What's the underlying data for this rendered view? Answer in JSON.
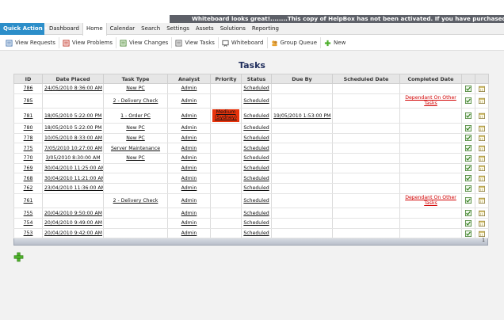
{
  "notice": "Whiteboard looks great!........This copy of HelpBox has not been activated. If you have purchased HelpBox, p",
  "menu": {
    "quick_action": "Quick Action ▾",
    "items": [
      "Dashboard",
      "Home",
      "Calendar",
      "Search",
      "Settings",
      "Assets",
      "Solutions",
      "Reporting"
    ]
  },
  "toolbar": {
    "buttons": [
      "View Requests",
      "View Problems",
      "View Changes",
      "View Tasks",
      "Whiteboard",
      "Group Queue",
      "New"
    ]
  },
  "page_title": "Tasks",
  "table": {
    "headers": [
      "ID",
      "Date Placed",
      "Task Type",
      "Analyst",
      "Priority",
      "Status",
      "Due By",
      "Scheduled Date",
      "Completed Date"
    ],
    "rows": [
      [
        "786",
        "24/05/2010 8:36:00 AM",
        "New PC",
        "Admin",
        "",
        "Scheduled",
        "",
        "",
        ""
      ],
      [
        "785",
        "",
        "2 - Delivery Check",
        "Admin",
        "",
        "Scheduled",
        "",
        "",
        "Dependant On Other Tasks"
      ],
      [
        "781",
        "18/05/2010 5:22:00 PM",
        "1 - Order PC",
        "Admin",
        "Medium (Sydney)",
        "Scheduled",
        "19/05/2010 1:53:00 PM",
        "",
        ""
      ],
      [
        "780",
        "18/05/2010 5:22:00 PM",
        "New PC",
        "Admin",
        "",
        "Scheduled",
        "",
        "",
        ""
      ],
      [
        "778",
        "10/05/2010 8:33:00 AM",
        "New PC",
        "Admin",
        "",
        "Scheduled",
        "",
        "",
        ""
      ],
      [
        "775",
        "7/05/2010 10:27:00 AM",
        "Server Maintenance",
        "Admin",
        "",
        "Scheduled",
        "",
        "",
        ""
      ],
      [
        "770",
        "3/05/2010 8:30:00 AM",
        "New PC",
        "Admin",
        "",
        "Scheduled",
        "",
        "",
        ""
      ],
      [
        "769",
        "30/04/2010 11:25:00 AM",
        "",
        "Admin",
        "",
        "Scheduled",
        "",
        "",
        ""
      ],
      [
        "768",
        "30/04/2010 11:21:00 AM",
        "",
        "Admin",
        "",
        "Scheduled",
        "",
        "",
        ""
      ],
      [
        "762",
        "23/04/2010 11:36:00 AM",
        "",
        "Admin",
        "",
        "Scheduled",
        "",
        "",
        ""
      ],
      [
        "761",
        "",
        "2 - Delivery Check",
        "Admin",
        "",
        "Scheduled",
        "",
        "",
        "Dependant On Other Tasks"
      ],
      [
        "755",
        "20/04/2010 9:50:00 AM",
        "",
        "Admin",
        "",
        "Scheduled",
        "",
        "",
        ""
      ],
      [
        "754",
        "20/04/2010 9:49:00 AM",
        "",
        "Admin",
        "",
        "Scheduled",
        "",
        "",
        ""
      ],
      [
        "753",
        "20/04/2010 9:42:00 AM",
        "",
        "Admin",
        "",
        "Scheduled",
        "",
        "",
        ""
      ]
    ],
    "pager": "1"
  },
  "colors": {
    "quick_action": "#2c8ec9",
    "priority_medium": "#e8330c",
    "dependant_text": "#d10000",
    "title": "#1f2d5c"
  },
  "icons": {
    "toolbar": [
      "view-requests-icon",
      "view-problems-icon",
      "view-changes-icon",
      "view-tasks-icon",
      "whiteboard-icon",
      "group-queue-icon",
      "new-plus-icon"
    ],
    "row_actions": [
      "complete-check-icon",
      "calendar-icon"
    ],
    "add": "add-task-plus-icon"
  }
}
